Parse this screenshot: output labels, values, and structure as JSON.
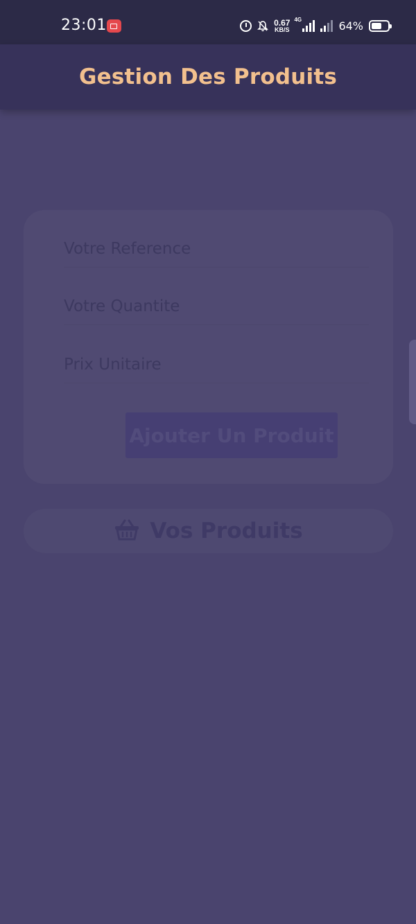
{
  "status_bar": {
    "time": "23:01",
    "net_speed_value": "0.67",
    "net_speed_unit": "KB/S",
    "network_type": "4G",
    "battery": "64%",
    "battery_level": 0.64
  },
  "app_bar": {
    "title": "Gestion Des Produits"
  },
  "form": {
    "reference_placeholder": "Votre Reference",
    "quantity_placeholder": "Votre Quantite",
    "price_placeholder": "Prix Unitaire",
    "add_button_label": "Ajouter Un Produit"
  },
  "products_button": {
    "icon": "basket-icon",
    "label": "Vos Produits"
  },
  "colors": {
    "background": "#4a446e",
    "app_bar": "#37325a",
    "title": "#f2c08e",
    "status_bar": "#2c2a47"
  }
}
